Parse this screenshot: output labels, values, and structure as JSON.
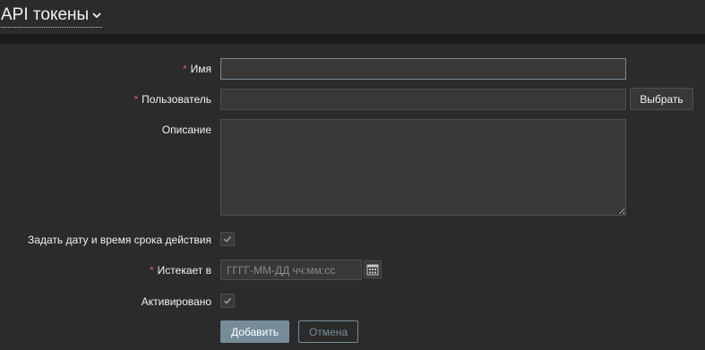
{
  "page": {
    "title": "API токены"
  },
  "form": {
    "name": {
      "label": "Имя",
      "required_mark": "*",
      "value": ""
    },
    "user": {
      "label": "Пользователь",
      "required_mark": "*",
      "value": "",
      "select_button": "Выбрать"
    },
    "description": {
      "label": "Описание",
      "value": ""
    },
    "set_expiry": {
      "label": "Задать дату и время срока действия",
      "checked": true
    },
    "expires": {
      "label": "Истекает в",
      "required_mark": "*",
      "value": "",
      "placeholder": "ГГГГ-ММ-ДД чч:мм:сс"
    },
    "enabled": {
      "label": "Активировано",
      "checked": true
    }
  },
  "buttons": {
    "add": "Добавить",
    "cancel": "Отмена"
  },
  "colors": {
    "background": "#2b2b2b",
    "divider": "#1a1a1a",
    "input_bg": "#383838",
    "input_border": "#4f4f4f",
    "required": "#e45959",
    "primary_button": "#768d99"
  },
  "icons": {
    "title_dropdown": "chevron-down-icon",
    "checkbox": "checkmark-icon",
    "calendar": "calendar-icon"
  }
}
